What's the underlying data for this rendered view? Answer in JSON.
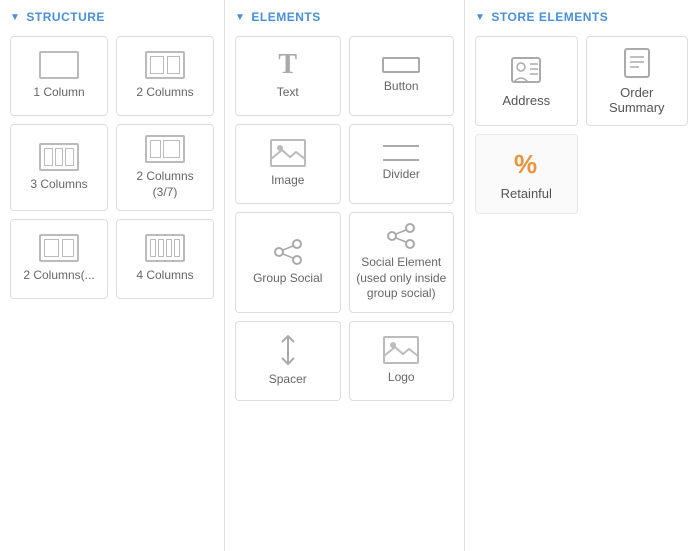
{
  "structure": {
    "header": "Structure",
    "items": [
      {
        "id": "1col",
        "label": "1 Column"
      },
      {
        "id": "2col",
        "label": "2 Columns"
      },
      {
        "id": "3col",
        "label": "3 Columns"
      },
      {
        "id": "2col-37",
        "label": "2 Columns (3/7)"
      },
      {
        "id": "2col-left",
        "label": "2 Columns(..."
      },
      {
        "id": "4col",
        "label": "4 Columns"
      }
    ]
  },
  "elements": {
    "header": "Elements",
    "items": [
      {
        "id": "text",
        "label": "Text"
      },
      {
        "id": "button",
        "label": "Button"
      },
      {
        "id": "image",
        "label": "Image"
      },
      {
        "id": "divider",
        "label": "Divider"
      },
      {
        "id": "group-social",
        "label": "Group Social"
      },
      {
        "id": "social-element",
        "label": "Social Element",
        "sublabel": "(used only inside group social)"
      },
      {
        "id": "spacer",
        "label": "Spacer"
      },
      {
        "id": "logo",
        "label": "Logo"
      }
    ]
  },
  "store": {
    "header": "Store Elements",
    "items": [
      {
        "id": "address",
        "label": "Address"
      },
      {
        "id": "order-summary",
        "label": "Order Summary"
      },
      {
        "id": "retainful",
        "label": "Retainful"
      }
    ]
  }
}
